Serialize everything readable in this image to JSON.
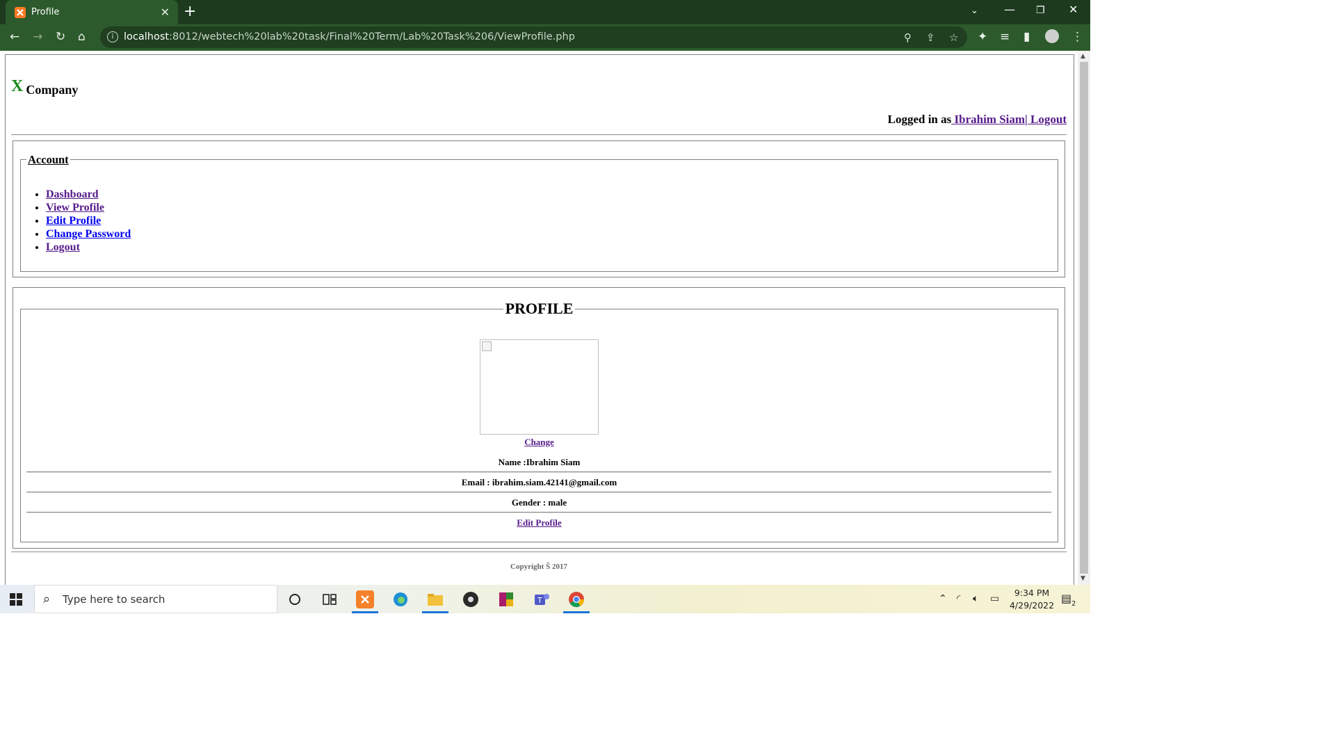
{
  "browser": {
    "tab_title": "Profile",
    "url_host": "localhost",
    "url_rest": ":8012/webtech%20lab%20task/Final%20Term/Lab%20Task%206/ViewProfile.php"
  },
  "header": {
    "logo_x": "X",
    "company": "Company",
    "logged_in_prefix": "Logged in as",
    "user_link": " Ibrahim Siam",
    "logout_link": "| Logout"
  },
  "account": {
    "legend": "Account",
    "menu": [
      "Dashboard",
      "View Profile",
      "Edit Profile",
      "Change Password",
      "Logout"
    ]
  },
  "profile": {
    "legend": "PROFILE",
    "change_link": "Change",
    "name_row": "Name :Ibrahim Siam",
    "email_row": "Email : ibrahim.siam.42141@gmail.com",
    "gender_row": "Gender : male",
    "edit_link": "Edit Profile"
  },
  "footer": {
    "copyright": "Copyright Š 2017"
  },
  "taskbar": {
    "search_placeholder": "Type here to search",
    "time": "9:34 PM",
    "date": "4/29/2022",
    "notification_count": "2"
  },
  "colors": {
    "tabbar": "#1d3a1f",
    "toolbar": "#2c5a2c",
    "visited_link": "#551a8b",
    "link": "#0000ee",
    "logo_green": "#1a8a1a"
  }
}
